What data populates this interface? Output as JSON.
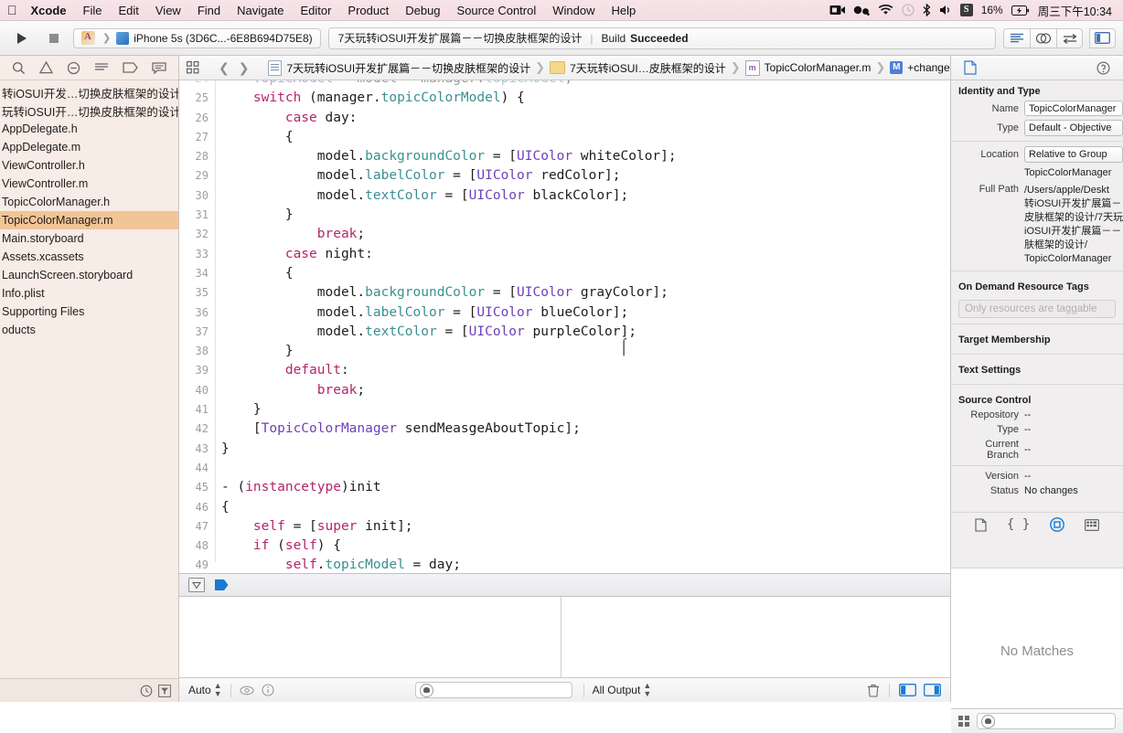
{
  "menubar": {
    "apple_glyph": "apple-logo",
    "items": [
      "Xcode",
      "File",
      "Edit",
      "View",
      "Find",
      "Navigate",
      "Editor",
      "Product",
      "Debug",
      "Source Control",
      "Window",
      "Help"
    ],
    "status_icons": [
      "screen-record-icon",
      "monkey-icon",
      "wifi-icon",
      "time-machine-icon",
      "bluetooth-icon",
      "volume-icon"
    ],
    "input_method": "S",
    "battery": "16%",
    "battery_glyph": "charging-bolt-icon",
    "clock": "周三下午10:34"
  },
  "toolbar": {
    "run_label": "run-button",
    "stop_label": "stop-button",
    "scheme_name": "iPhone 5s (3D6C...-6E8B694D75E8)",
    "scheme_project_icon": "xcode-project-icon",
    "status_title": "7天玩转iOSUI开发扩展篇－－切换皮肤框架的设计",
    "status_separator": "|",
    "status_build_prefix": "Build",
    "status_build_result": "Succeeded",
    "editor_modes": [
      "standard-editor-icon",
      "assistant-editor-icon",
      "version-editor-icon"
    ],
    "view_toggles": [
      "navigator-toggle-icon",
      "debug-toggle-icon",
      "utilities-toggle-icon"
    ]
  },
  "navigator": {
    "tabs": [
      "project-navigator-icon",
      "issue-navigator-icon",
      "test-navigator-icon",
      "debug-navigator-icon",
      "breakpoint-navigator-icon",
      "report-navigator-icon"
    ],
    "items": [
      {
        "label": "转iOSUI开发…切换皮肤框架的设计",
        "selected": false
      },
      {
        "label": "玩转iOSUI开…切换皮肤框架的设计",
        "selected": false
      },
      {
        "label": "AppDelegate.h",
        "selected": false
      },
      {
        "label": "AppDelegate.m",
        "selected": false
      },
      {
        "label": "ViewController.h",
        "selected": false
      },
      {
        "label": "ViewController.m",
        "selected": false
      },
      {
        "label": "TopicColorManager.h",
        "selected": false
      },
      {
        "label": "TopicColorManager.m",
        "selected": true
      },
      {
        "label": "Main.storyboard",
        "selected": false
      },
      {
        "label": "Assets.xcassets",
        "selected": false
      },
      {
        "label": "LaunchScreen.storyboard",
        "selected": false
      },
      {
        "label": "Info.plist",
        "selected": false
      },
      {
        "label": "Supporting Files",
        "selected": false
      },
      {
        "label": "oducts",
        "selected": false
      }
    ],
    "footer_icons": [
      "recent-files-icon",
      "filter-icon"
    ]
  },
  "jumpbar": {
    "related_items_icon": "related-items-icon",
    "back_icon": "back-chevron-icon",
    "forward_icon": "forward-chevron-icon",
    "crumbs": [
      {
        "icon": "project-icon",
        "label": "7天玩转iOSUI开发扩展篇－－切换皮肤框架的设计"
      },
      {
        "icon": "folder-icon",
        "label": "7天玩转iOSUI…皮肤框架的设计"
      },
      {
        "icon": "m-file-icon",
        "label": "TopicColorManager.m"
      },
      {
        "icon": "method-icon",
        "label": "+changeTopicModel:"
      }
    ]
  },
  "editor": {
    "first_line_number": 24,
    "lines": [
      {
        "n": 24,
        "partial": true,
        "tokens": [
          {
            "t": "    ",
            "c": "pln"
          },
          {
            "t": "TopicModel",
            "c": "cls"
          },
          {
            "t": " * model = manager.",
            "c": "pln"
          },
          {
            "t": "topicModel",
            "c": "prop"
          },
          {
            "t": ";",
            "c": "pln"
          }
        ]
      },
      {
        "n": 25,
        "tokens": [
          {
            "t": "    ",
            "c": "pln"
          },
          {
            "t": "switch",
            "c": "kw"
          },
          {
            "t": " (manager.",
            "c": "pln"
          },
          {
            "t": "topicColorModel",
            "c": "prop"
          },
          {
            "t": ") {",
            "c": "pln"
          }
        ]
      },
      {
        "n": 26,
        "tokens": [
          {
            "t": "        ",
            "c": "pln"
          },
          {
            "t": "case",
            "c": "kw"
          },
          {
            "t": " day:",
            "c": "pln"
          }
        ]
      },
      {
        "n": 27,
        "tokens": [
          {
            "t": "        {",
            "c": "pln"
          }
        ]
      },
      {
        "n": 28,
        "tokens": [
          {
            "t": "            model.",
            "c": "pln"
          },
          {
            "t": "backgroundColor",
            "c": "prop"
          },
          {
            "t": " = [",
            "c": "pln"
          },
          {
            "t": "UIColor",
            "c": "cls"
          },
          {
            "t": " whiteColor];",
            "c": "pln"
          }
        ]
      },
      {
        "n": 29,
        "tokens": [
          {
            "t": "            model.",
            "c": "pln"
          },
          {
            "t": "labelColor",
            "c": "prop"
          },
          {
            "t": " = [",
            "c": "pln"
          },
          {
            "t": "UIColor",
            "c": "cls"
          },
          {
            "t": " redColor];",
            "c": "pln"
          }
        ]
      },
      {
        "n": 30,
        "tokens": [
          {
            "t": "            model.",
            "c": "pln"
          },
          {
            "t": "textColor",
            "c": "prop"
          },
          {
            "t": " = [",
            "c": "pln"
          },
          {
            "t": "UIColor",
            "c": "cls"
          },
          {
            "t": " blackColor];",
            "c": "pln"
          }
        ]
      },
      {
        "n": 31,
        "tokens": [
          {
            "t": "        }",
            "c": "pln"
          }
        ]
      },
      {
        "n": 32,
        "tokens": [
          {
            "t": "            ",
            "c": "pln"
          },
          {
            "t": "break",
            "c": "kw"
          },
          {
            "t": ";",
            "c": "pln"
          }
        ]
      },
      {
        "n": 33,
        "tokens": [
          {
            "t": "        ",
            "c": "pln"
          },
          {
            "t": "case",
            "c": "kw"
          },
          {
            "t": " night:",
            "c": "pln"
          }
        ]
      },
      {
        "n": 34,
        "tokens": [
          {
            "t": "        {",
            "c": "pln"
          }
        ]
      },
      {
        "n": 35,
        "tokens": [
          {
            "t": "            model.",
            "c": "pln"
          },
          {
            "t": "backgroundColor",
            "c": "prop"
          },
          {
            "t": " = [",
            "c": "pln"
          },
          {
            "t": "UIColor",
            "c": "cls"
          },
          {
            "t": " grayColor];",
            "c": "pln"
          }
        ]
      },
      {
        "n": 36,
        "tokens": [
          {
            "t": "            model.",
            "c": "pln"
          },
          {
            "t": "labelColor",
            "c": "prop"
          },
          {
            "t": " = [",
            "c": "pln"
          },
          {
            "t": "UIColor",
            "c": "cls"
          },
          {
            "t": " blueColor];",
            "c": "pln"
          }
        ]
      },
      {
        "n": 37,
        "tokens": [
          {
            "t": "            model.",
            "c": "pln"
          },
          {
            "t": "textColor",
            "c": "prop"
          },
          {
            "t": " = [",
            "c": "pln"
          },
          {
            "t": "UIColor",
            "c": "cls"
          },
          {
            "t": " purpleColor];",
            "c": "pln"
          }
        ]
      },
      {
        "n": 38,
        "tokens": [
          {
            "t": "        }",
            "c": "pln"
          }
        ]
      },
      {
        "n": 39,
        "tokens": [
          {
            "t": "        ",
            "c": "pln"
          },
          {
            "t": "default",
            "c": "kw"
          },
          {
            "t": ":",
            "c": "pln"
          }
        ]
      },
      {
        "n": 40,
        "tokens": [
          {
            "t": "            ",
            "c": "pln"
          },
          {
            "t": "break",
            "c": "kw"
          },
          {
            "t": ";",
            "c": "pln"
          }
        ]
      },
      {
        "n": 41,
        "tokens": [
          {
            "t": "    }",
            "c": "pln"
          }
        ]
      },
      {
        "n": 42,
        "tokens": [
          {
            "t": "    [",
            "c": "pln"
          },
          {
            "t": "TopicColorManager",
            "c": "cls"
          },
          {
            "t": " sendMeasgeAboutTopic];",
            "c": "pln"
          }
        ]
      },
      {
        "n": 43,
        "tokens": [
          {
            "t": "}",
            "c": "pln"
          }
        ]
      },
      {
        "n": 44,
        "tokens": [
          {
            "t": "",
            "c": "pln"
          }
        ]
      },
      {
        "n": 45,
        "tokens": [
          {
            "t": "- (",
            "c": "pln"
          },
          {
            "t": "instancetype",
            "c": "kw"
          },
          {
            "t": ")init",
            "c": "pln"
          }
        ]
      },
      {
        "n": 46,
        "tokens": [
          {
            "t": "{",
            "c": "pln"
          }
        ]
      },
      {
        "n": 47,
        "tokens": [
          {
            "t": "    ",
            "c": "pln"
          },
          {
            "t": "self",
            "c": "kw"
          },
          {
            "t": " = [",
            "c": "pln"
          },
          {
            "t": "super",
            "c": "kw"
          },
          {
            "t": " init];",
            "c": "pln"
          }
        ]
      },
      {
        "n": 48,
        "tokens": [
          {
            "t": "    ",
            "c": "pln"
          },
          {
            "t": "if",
            "c": "kw"
          },
          {
            "t": " (",
            "c": "pln"
          },
          {
            "t": "self",
            "c": "kw"
          },
          {
            "t": ") {",
            "c": "pln"
          }
        ]
      },
      {
        "n": 49,
        "tokens": [
          {
            "t": "        ",
            "c": "pln"
          },
          {
            "t": "self",
            "c": "kw"
          },
          {
            "t": ".",
            "c": "pln"
          },
          {
            "t": "topicModel",
            "c": "prop"
          },
          {
            "t": " = day;",
            "c": "pln"
          }
        ]
      }
    ],
    "syntax_colors": {
      "keyword": "#b4256b",
      "property": "#3a8f92",
      "class": "#6f3fb8",
      "plain": "#1d1d1d",
      "gutter": "#9e9e9e",
      "background": "#ffffff"
    }
  },
  "debug_area": {
    "toolbar_icons": [
      "hide-console-icon",
      "continue-flag-icon"
    ],
    "variables_scope": "Auto",
    "variables_scope_icon": "stepper-icon",
    "eye_icon": "eye-icon",
    "info_icon": "info-icon",
    "filter_placeholder": "",
    "filter_bubble_icon": "filter-bubble-icon",
    "output_scope": "All Output",
    "trash_icon": "trash-icon",
    "split_toggles": [
      "variables-view-toggle",
      "console-view-toggle"
    ],
    "console_filter_placeholder": ""
  },
  "inspector": {
    "tabs_left": [
      "file-inspector-icon",
      "quick-help-icon"
    ],
    "sections": {
      "identity_and_type": {
        "title": "Identity and Type",
        "rows": [
          {
            "key": "Name",
            "value": "TopicColorManager",
            "type": "textfield"
          },
          {
            "key": "Type",
            "value": "Default - Objective",
            "type": "popup"
          },
          {
            "key": "Location",
            "value": "Relative to Group",
            "type": "popup"
          },
          {
            "key": "",
            "value": "TopicColorManager",
            "type": "static"
          },
          {
            "key": "Full Path",
            "value": "/Users/apple/Deskt",
            "type": "path"
          }
        ],
        "full_path_lines": [
          "/Users/apple/Deskt",
          "转iOSUI开发扩展篇－",
          "皮肤框架的设计/7天玩",
          "iOSUI开发扩展篇－－",
          "肤框架的设计/",
          "TopicColorManager"
        ]
      },
      "on_demand_resource_tags": {
        "title": "On Demand Resource Tags",
        "placeholder": "Only resources are taggable"
      },
      "target_membership": {
        "title": "Target Membership"
      },
      "text_settings": {
        "title": "Text Settings"
      },
      "source_control": {
        "title": "Source Control",
        "rows": [
          {
            "key": "Repository",
            "value": "--"
          },
          {
            "key": "Type",
            "value": "--"
          },
          {
            "key": "Current Branch",
            "value": "--"
          },
          {
            "key": "Version",
            "value": "--"
          },
          {
            "key": "Status",
            "value": "No changes"
          }
        ]
      }
    },
    "library_tabs": [
      "file-template-library-icon",
      "code-snippet-library-icon",
      "object-library-icon",
      "media-library-icon"
    ],
    "library_selected_index": 2,
    "library_empty_message": "No Matches",
    "library_filter_placeholder": "",
    "library_grid_icon": "library-grid-icon"
  },
  "colors": {
    "menubar_bg": "#f3dde3",
    "navigator_bg": "#f7ece6",
    "navigator_selection": "#f2c597",
    "inspector_bg": "#f0eeee",
    "accent_blue": "#1a7bd4"
  }
}
